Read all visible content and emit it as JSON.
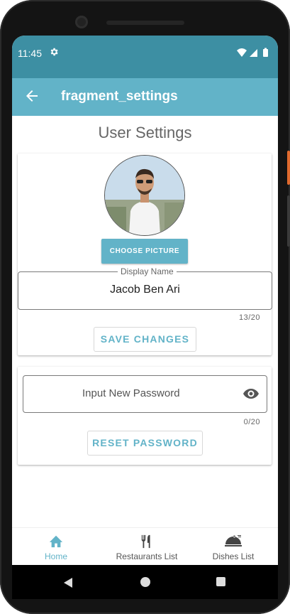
{
  "status_bar": {
    "time": "11:45",
    "settings_icon": "gear-icon",
    "icons": [
      "wifi-icon",
      "signal-icon",
      "battery-icon"
    ]
  },
  "app_bar": {
    "title": "fragment_settings",
    "back_icon": "arrow-back-icon"
  },
  "page": {
    "title": "User Settings"
  },
  "profile_card": {
    "choose_picture_label": "CHOOSE PICTURE",
    "display_name_label": "Display Name",
    "display_name_value": "Jacob Ben Ari",
    "display_name_counter": "13/20",
    "save_label": "SAVE CHANGES"
  },
  "password_card": {
    "placeholder": "Input New Password",
    "counter": "0/20",
    "reset_label": "RESET PASSWORD"
  },
  "bottom_nav": {
    "items": [
      {
        "label": "Home",
        "icon": "home-icon",
        "active": true
      },
      {
        "label": "Restaurants List",
        "icon": "fork-knife-icon",
        "active": false
      },
      {
        "label": "Dishes List",
        "icon": "cloche-icon",
        "active": false
      }
    ]
  },
  "colors": {
    "primary": "#62b3c8",
    "primary_dark": "#3d8fa3",
    "text_secondary": "#666666"
  }
}
